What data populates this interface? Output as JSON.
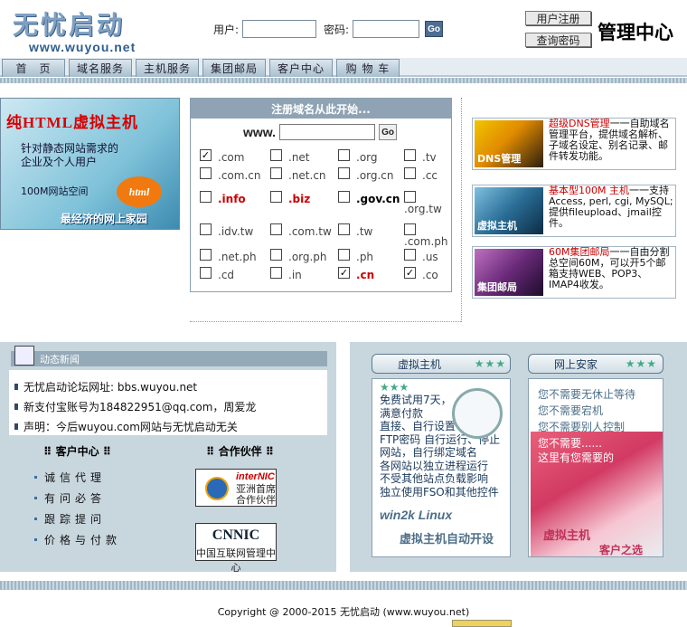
{
  "logo": {
    "cn": "无忧启动",
    "url": "www.wuyou.net"
  },
  "login": {
    "user_label": "用户:",
    "pass_label": "密码:",
    "go": "Go"
  },
  "top": {
    "register": "用户注册",
    "query_pw": "查询密码",
    "manage": "管理中心"
  },
  "nav": [
    "首　页",
    "域名服务",
    "主机服务",
    "集团邮局",
    "客户中心",
    "购 物 车"
  ],
  "promo": {
    "title": "纯HTML虚拟主机",
    "line": "针对静态网站需求的企业及个人用户",
    "space": "100M网站空间",
    "badge": "html",
    "slogan": "最经济的网上家园"
  },
  "domain": {
    "header": "注册域名从此开始...",
    "prefix": "www.",
    "go": "Go",
    "tlds": [
      {
        "t": ".com",
        "c": true,
        "red": false
      },
      {
        "t": ".net",
        "c": false,
        "red": false
      },
      {
        "t": ".org",
        "c": false,
        "red": false
      },
      {
        "t": ".tv",
        "c": false,
        "red": false
      },
      {
        "t": ".com.cn",
        "c": false,
        "red": false
      },
      {
        "t": ".net.cn",
        "c": false,
        "red": false
      },
      {
        "t": ".org.cn",
        "c": false,
        "red": false
      },
      {
        "t": ".cc",
        "c": false,
        "red": false
      },
      {
        "t": ".info",
        "c": false,
        "red": true
      },
      {
        "t": ".biz",
        "c": false,
        "red": true
      },
      {
        "t": ".gov.cn",
        "c": false,
        "red": false
      },
      {
        "t": ".org.tw",
        "c": false,
        "red": false
      },
      {
        "t": ".idv.tw",
        "c": false,
        "red": false
      },
      {
        "t": ".com.tw",
        "c": false,
        "red": false
      },
      {
        "t": ".tw",
        "c": false,
        "red": false
      },
      {
        "t": ".com.ph",
        "c": false,
        "red": false
      },
      {
        "t": ".net.ph",
        "c": false,
        "red": false
      },
      {
        "t": ".org.ph",
        "c": false,
        "red": false
      },
      {
        "t": ".ph",
        "c": false,
        "red": false
      },
      {
        "t": ".us",
        "c": false,
        "red": false
      },
      {
        "t": ".cd",
        "c": false,
        "red": false
      },
      {
        "t": ".in",
        "c": false,
        "red": false
      },
      {
        "t": ".cn",
        "c": true,
        "red": true
      },
      {
        "t": ".co",
        "c": true,
        "red": false
      }
    ]
  },
  "services": [
    {
      "img": "DNS管理",
      "hl": "超级DNS管理",
      "text": "一一自助域名管理平台，提供域名解析、子域名设定、别名记录、邮件转发功能。"
    },
    {
      "img": "虚拟主机",
      "hl": "基本型100M 主机",
      "text": "一一支持Access, perl, cgi, MySQL;提供fileupload、jmail控件。"
    },
    {
      "img": "集团邮局",
      "hl": "60M集团邮局",
      "text": "一一自由分割总空间60M，可以开5个邮箱支持WEB、POP3、IMAP4收发。"
    }
  ],
  "news": {
    "title": "动态新闻",
    "items": [
      "无忧启动论坛网址: bbs.wuyou.net",
      "新支付宝账号为184822951@qq.com，周爱龙",
      "声明：今后wuyou.com网站与无忧启动无关"
    ]
  },
  "client": {
    "title": "客户中心",
    "items": [
      "诚信代理",
      "有问必答",
      "跟踪提问",
      "价格与付款"
    ]
  },
  "partners": {
    "title": "合作伙伴",
    "p1_brand": "interNIC",
    "p1_text": "亚洲首席合作伙伴",
    "p2_brand": "CNNIC",
    "p2_text": "中国互联网管理中心"
  },
  "vhost": {
    "title": "虚拟主机",
    "stars": "★★★",
    "lines": [
      "免费试用7天，",
      "满意付款",
      "直接、自行设置",
      "FTP密码 自行运行、停止",
      "网站，自行绑定域名",
      "各网站以独立进程运行",
      "不受其他站点负载影响",
      "独立使用FSO和其他控件"
    ],
    "brand": "win2k Linux",
    "tag": "虚拟主机自动开设"
  },
  "security": {
    "title": "网上安家",
    "stars": "★★★",
    "lines": [
      "您不需要无休止等待",
      "您不需要宕机",
      "您不需要别人控制"
    ],
    "pink1": "您不需要......",
    "pink2": "这里有您需要的",
    "pink3": "虚拟主机",
    "pink4": "客户之选"
  },
  "footer": {
    "copyright": "Copyright @ 2000-2015 无忧启动 (www.wuyou.net)"
  }
}
